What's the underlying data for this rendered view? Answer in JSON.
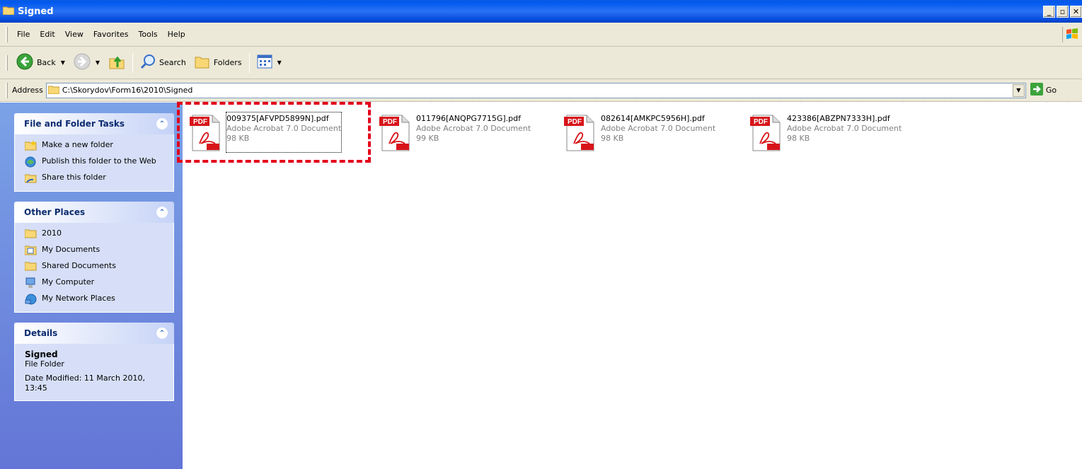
{
  "window": {
    "title": "Signed",
    "controls": [
      "_",
      "̅̅□",
      "×"
    ]
  },
  "menu": {
    "items": [
      "File",
      "Edit",
      "View",
      "Favorites",
      "Tools",
      "Help"
    ]
  },
  "toolbar": {
    "back_label": "Back",
    "search_label": "Search",
    "folders_label": "Folders"
  },
  "address": {
    "label": "Address",
    "value": "C:\\Skorydov\\Form16\\2010\\Signed",
    "go_label": "Go"
  },
  "taskpane": {
    "file_tasks": {
      "title": "File and Folder Tasks",
      "items": [
        {
          "label": "Make a new folder",
          "icon": "new-folder-icon"
        },
        {
          "label": "Publish this folder to the Web",
          "icon": "publish-web-icon"
        },
        {
          "label": "Share this folder",
          "icon": "share-folder-icon"
        }
      ]
    },
    "other_places": {
      "title": "Other Places",
      "items": [
        {
          "label": "2010",
          "icon": "folder-icon"
        },
        {
          "label": "My Documents",
          "icon": "my-documents-icon"
        },
        {
          "label": "Shared Documents",
          "icon": "folder-icon"
        },
        {
          "label": "My Computer",
          "icon": "my-computer-icon"
        },
        {
          "label": "My Network Places",
          "icon": "network-places-icon"
        }
      ]
    },
    "details": {
      "title": "Details",
      "name": "Signed",
      "type": "File Folder",
      "modified": "Date Modified: 11 March 2010, 13:45"
    }
  },
  "files": [
    {
      "name": "009375[AFVPD5899N].pdf",
      "type": "Adobe Acrobat 7.0 Document",
      "size": "98 KB",
      "selected": true
    },
    {
      "name": "011796[ANQPG7715G].pdf",
      "type": "Adobe Acrobat 7.0 Document",
      "size": "99 KB",
      "selected": false
    },
    {
      "name": "082614[AMKPC5956H].pdf",
      "type": "Adobe Acrobat 7.0 Document",
      "size": "98 KB",
      "selected": false
    },
    {
      "name": "423386[ABZPN7333H].pdf",
      "type": "Adobe Acrobat 7.0 Document",
      "size": "98 KB",
      "selected": false
    }
  ],
  "colors": {
    "titlebar": "#0058ee",
    "taskpane": "#6f8ee0",
    "highlight": "#e3001b",
    "pdf_red": "#d7141a"
  }
}
